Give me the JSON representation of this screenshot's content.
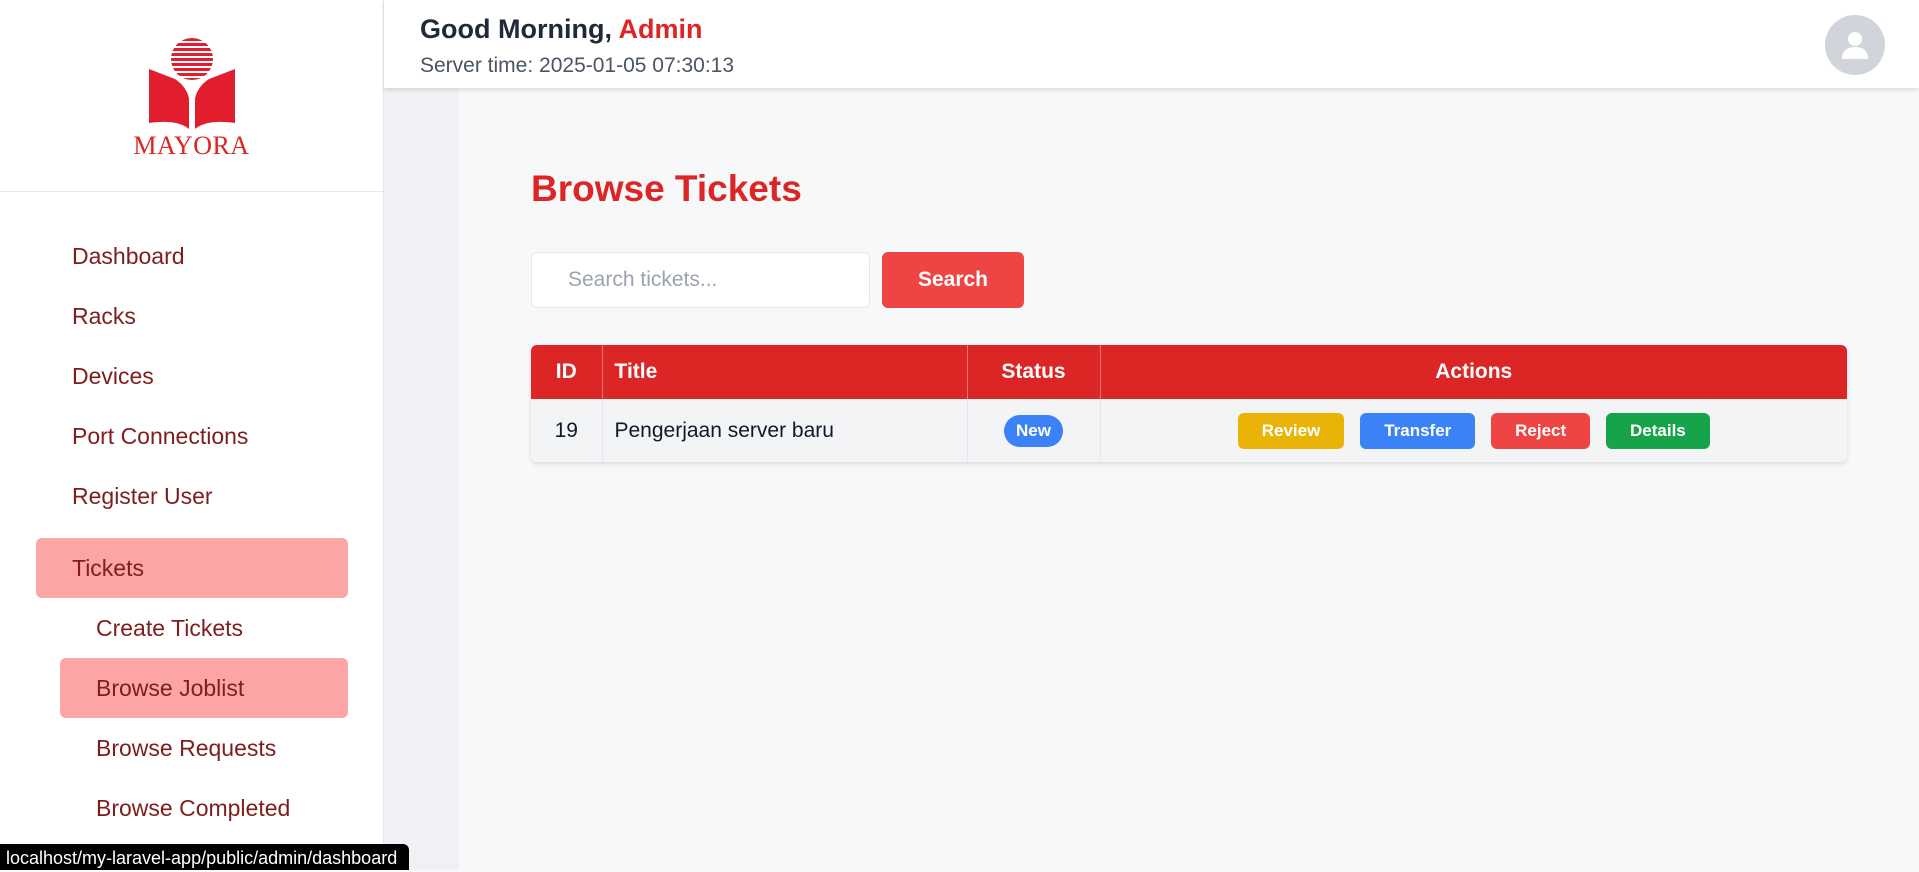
{
  "brand": {
    "name": "MAYORA",
    "accent": "#dc2626"
  },
  "sidebar": {
    "items": [
      {
        "label": "Dashboard"
      },
      {
        "label": "Racks"
      },
      {
        "label": "Devices"
      },
      {
        "label": "Port Connections"
      },
      {
        "label": "Register User"
      },
      {
        "label": "Tickets",
        "active": true
      }
    ],
    "sub_items": [
      {
        "label": "Create Tickets"
      },
      {
        "label": "Browse Joblist",
        "active": true
      },
      {
        "label": "Browse Requests"
      },
      {
        "label": "Browse Completed"
      }
    ]
  },
  "header": {
    "greeting": "Good Morning,",
    "user": "Admin",
    "server_time": "Server time: 2025-01-05 07:30:13",
    "avatar_icon": "user-icon"
  },
  "main": {
    "title": "Browse Tickets",
    "search": {
      "placeholder": "Search tickets...",
      "value": "",
      "button_label": "Search"
    },
    "table": {
      "columns": [
        "ID",
        "Title",
        "Status",
        "Actions"
      ],
      "rows": [
        {
          "id": "19",
          "title": "Pengerjaan server baru",
          "status": "New",
          "actions": [
            "Review",
            "Transfer",
            "Reject",
            "Details"
          ]
        }
      ]
    }
  },
  "status_bar": {
    "url": "localhost/my-laravel-app/public/admin/dashboard"
  }
}
